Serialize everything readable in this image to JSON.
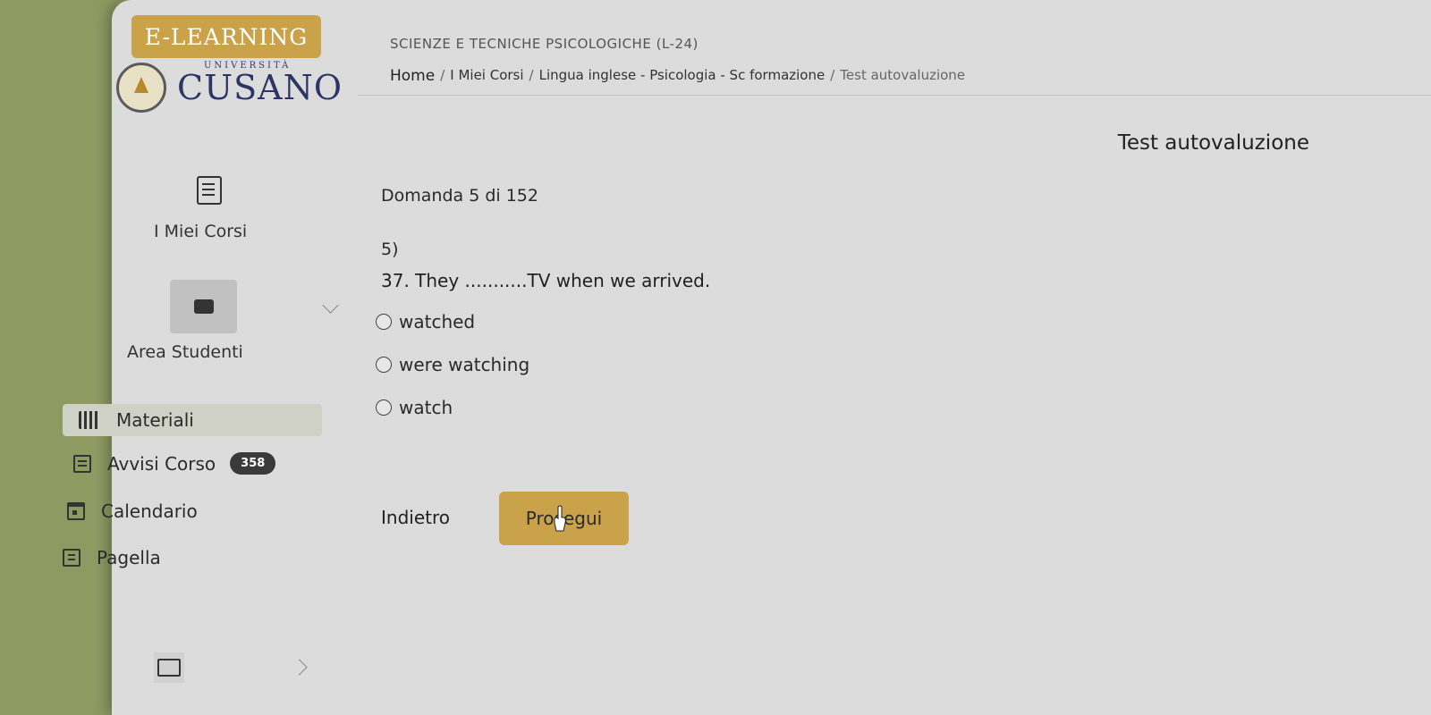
{
  "brand": {
    "elearning": "E-LEARNING",
    "university_small": "UNIVERSITÀ",
    "university_name": "CUSANO"
  },
  "header": {
    "program": "SCIENZE E TECNICHE PSICOLOGICHE (L-24)",
    "breadcrumb": [
      "Home",
      "I Miei Corsi",
      "Lingua inglese - Psicologia - Sc formazione",
      "Test autovaluzione"
    ],
    "separator": "/"
  },
  "page": {
    "title": "Test autovaluzione"
  },
  "sidebar": {
    "my_courses": "I Miei Corsi",
    "student_area": "Area Studenti",
    "menu": [
      {
        "label": "Materiali",
        "icon": "books-icon"
      },
      {
        "label": "Avvisi Corso",
        "icon": "chat-icon",
        "badge": "358"
      },
      {
        "label": "Calendario",
        "icon": "calendar-icon"
      },
      {
        "label": "Pagella",
        "icon": "report-card-icon"
      }
    ]
  },
  "quiz": {
    "counter": "Domanda 5 di 152",
    "number": "5)",
    "question": "37. They ...........TV when we arrived.",
    "options": [
      "watched",
      "were watching",
      "watch"
    ],
    "back_label": "Indietro",
    "next_label": "Prosegui"
  },
  "colors": {
    "accent": "#c9a24a",
    "background": "#dcdcdc",
    "brand_blue": "#2d3566"
  }
}
